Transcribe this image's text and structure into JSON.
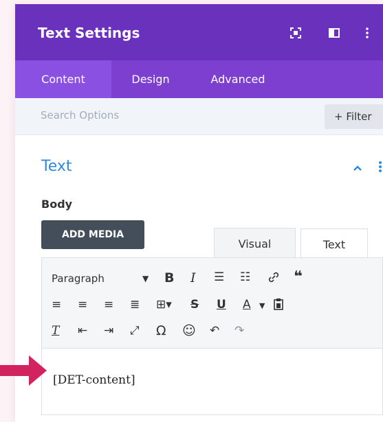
{
  "header": {
    "title": "Text Settings",
    "icons": [
      "focus-icon",
      "columns-icon",
      "more-vertical-icon"
    ]
  },
  "tabs": [
    {
      "label": "Content",
      "active": true
    },
    {
      "label": "Design",
      "active": false
    },
    {
      "label": "Advanced",
      "active": false
    }
  ],
  "search": {
    "placeholder": "Search Options",
    "filter_label": "+ Filter"
  },
  "section": {
    "title": "Text"
  },
  "body_field": {
    "label": "Body",
    "add_media_label": "ADD MEDIA",
    "visual_tab": "Visual",
    "text_tab": "Text"
  },
  "toolbar": {
    "format_select": "Paragraph",
    "icons": [
      "bold-icon",
      "italic-icon",
      "bulleted-list-icon",
      "numbered-list-icon",
      "link-icon",
      "blockquote-icon",
      "align-left-icon",
      "align-center-icon",
      "align-right-icon",
      "justify-icon",
      "table-icon",
      "strikethrough-icon",
      "underline-icon",
      "text-color-icon",
      "paste-text-icon",
      "clear-formatting-icon",
      "outdent-icon",
      "indent-icon",
      "fullscreen-icon",
      "special-character-icon",
      "emoji-icon",
      "undo-icon",
      "redo-icon"
    ]
  },
  "editor": {
    "content": "[DET-content]"
  },
  "colors": {
    "header": "#6a31bd",
    "tabs": "#7c3fd0",
    "active_tab": "#8a50e2",
    "accent": "#2d8be0",
    "arrow": "#d1245e"
  }
}
